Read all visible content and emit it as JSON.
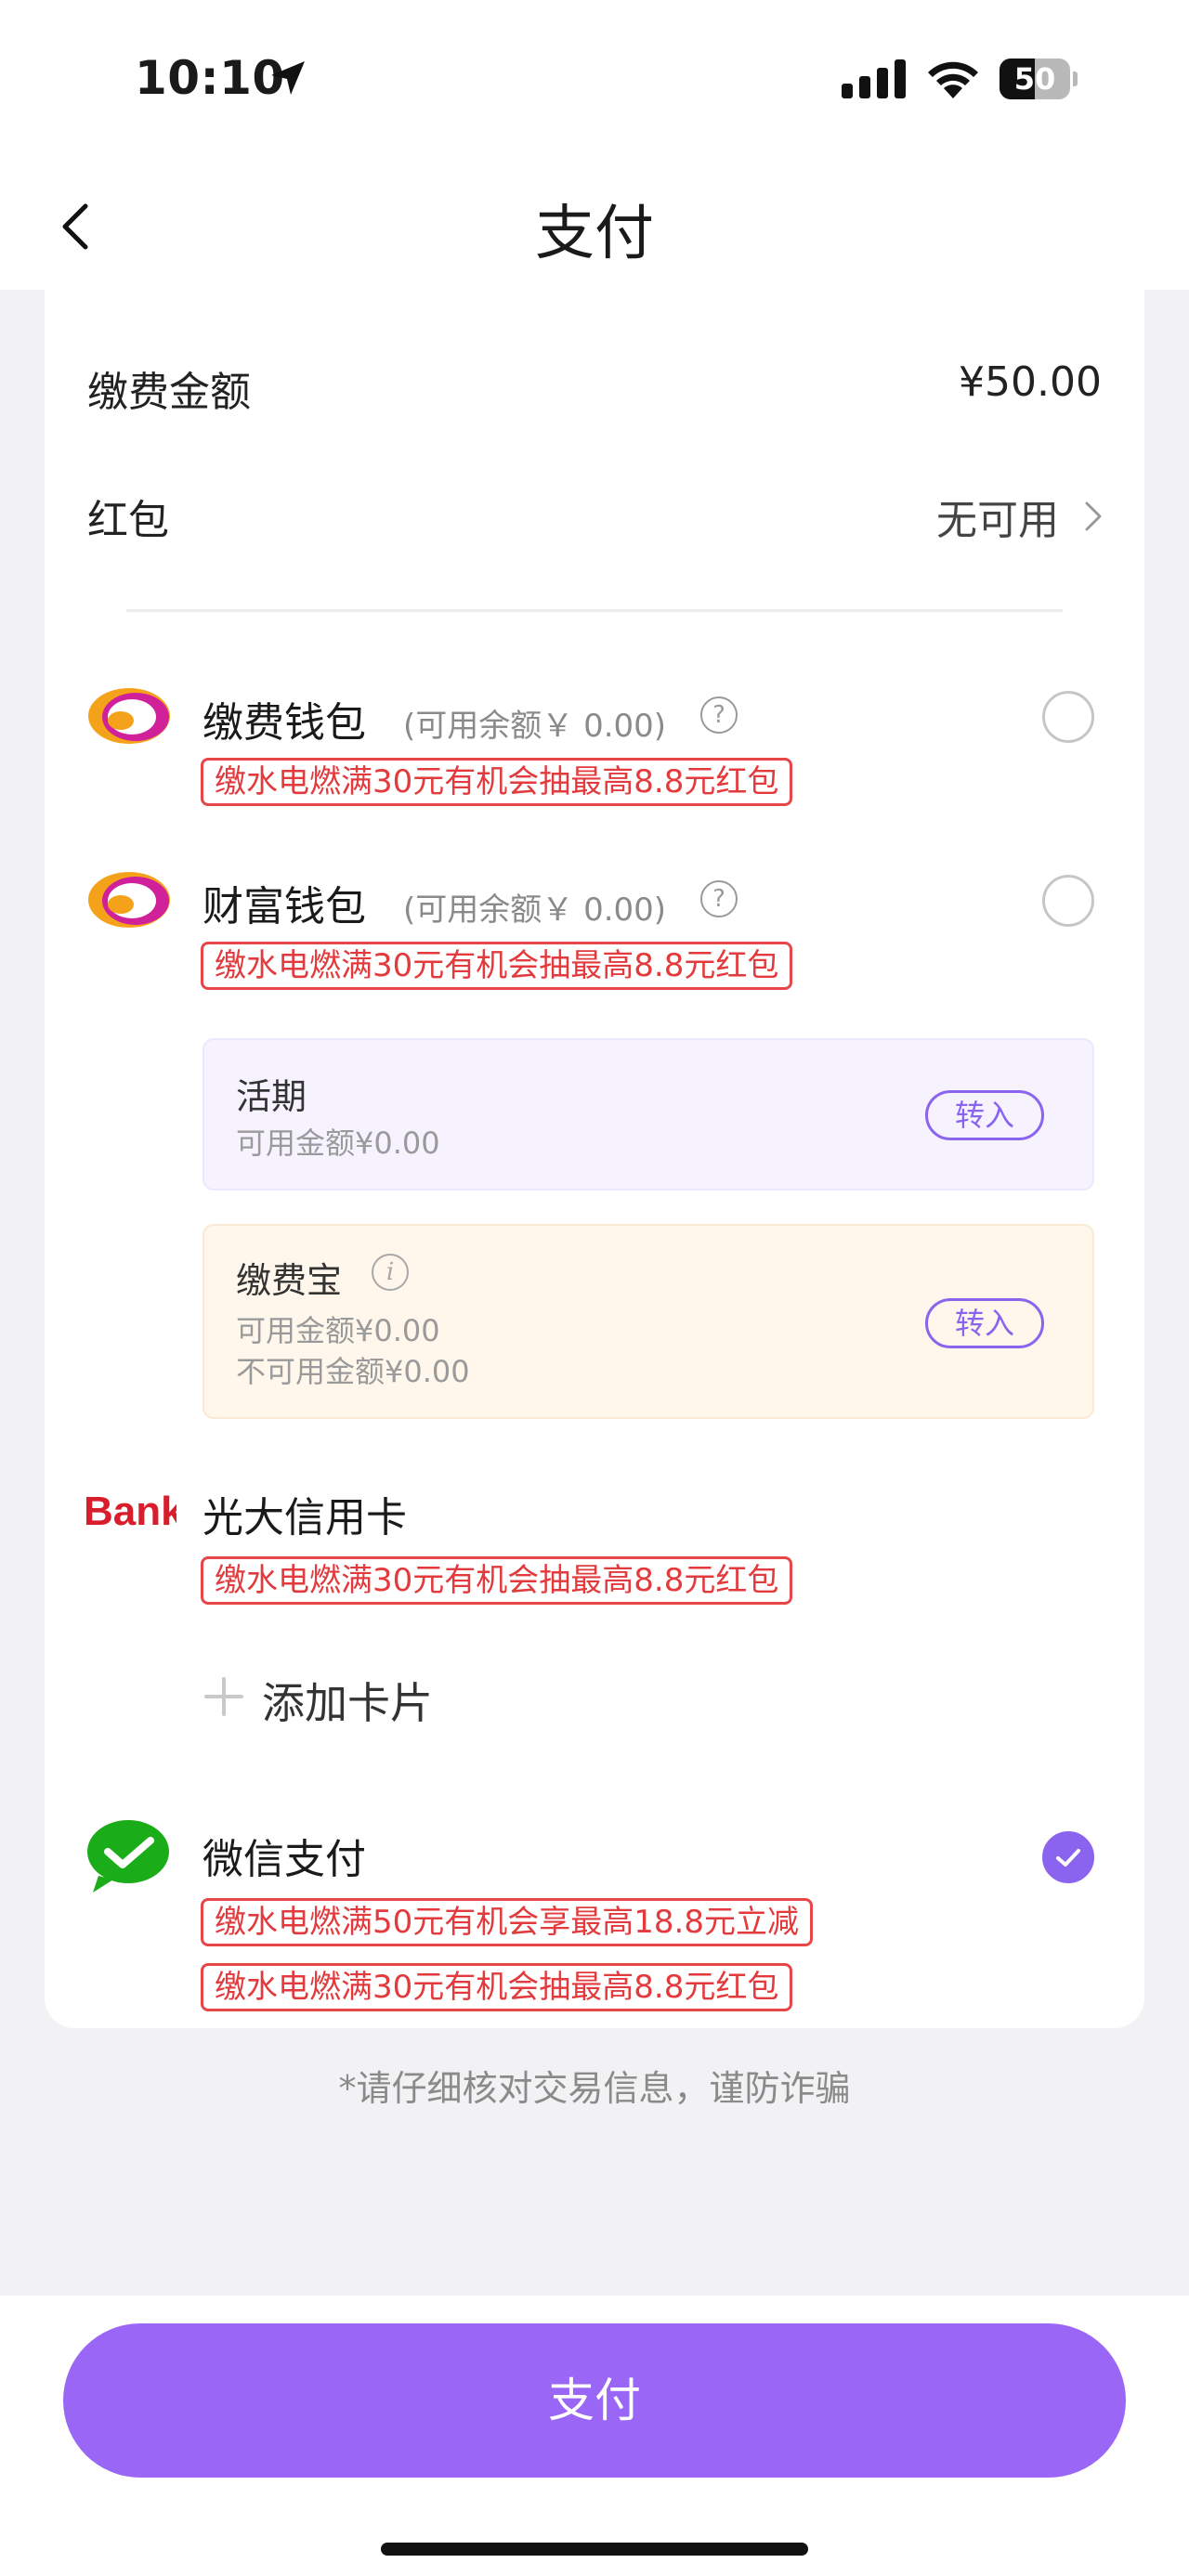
{
  "status_bar": {
    "time": "10:10",
    "battery": "50"
  },
  "nav": {
    "title": "支付",
    "back_icon": "chevron-left-icon"
  },
  "summary": {
    "amount_label": "缴费金额",
    "amount_value": "¥50.00",
    "redpacket_label": "红包",
    "redpacket_value": "无可用"
  },
  "methods": [
    {
      "title": "缴费钱包",
      "balance": "(可用余额￥ 0.00)",
      "promos": [
        "缴水电燃满30元有机会抽最高8.8元红包"
      ],
      "selected": false,
      "icon": "flower-logo-icon"
    },
    {
      "title": "财富钱包",
      "balance": "(可用余额￥ 0.00)",
      "promos": [
        "缴水电燃满30元有机会抽最高8.8元红包"
      ],
      "selected": false,
      "icon": "flower-logo-icon"
    },
    {
      "title": "光大信用卡",
      "promos": [
        "缴水电燃满30元有机会抽最高8.8元红包"
      ],
      "icon": "bank-logo-icon",
      "logo_text": "Bank"
    },
    {
      "title": "微信支付",
      "promos": [
        "缴水电燃满50元有机会享最高18.8元立减",
        "缴水电燃满30元有机会抽最高8.8元红包"
      ],
      "selected": true,
      "icon": "wechat-pay-icon"
    }
  ],
  "sub_accounts": [
    {
      "title": "活期",
      "lines": [
        "可用金额¥0.00"
      ],
      "action": "转入"
    },
    {
      "title": "缴费宝",
      "lines": [
        "可用金额¥0.00",
        "不可用金额¥0.00"
      ],
      "action": "转入"
    }
  ],
  "add_card_label": "添加卡片",
  "notice": "*请仔细核对交易信息，谨防诈骗",
  "pay_button": "支付",
  "colors": {
    "accent": "#9966f5",
    "promo": "#e23a3d",
    "wechat": "#1aad19"
  }
}
